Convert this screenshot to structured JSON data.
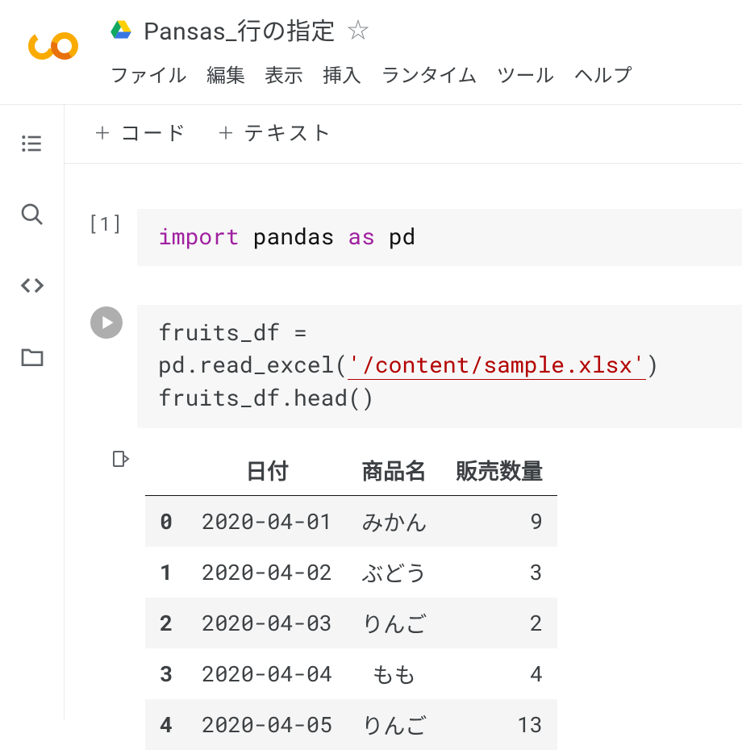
{
  "header": {
    "title": "Pansas_行の指定",
    "menubar": [
      "ファイル",
      "編集",
      "表示",
      "挿入",
      "ランタイム",
      "ツール",
      "ヘルプ"
    ]
  },
  "toolbar": {
    "add_code": "コード",
    "add_text": "テキスト"
  },
  "cells": [
    {
      "exec_label": "[1]",
      "code_parts": {
        "kw1": "import",
        "mod": "pandas",
        "kw2": "as",
        "alias": "pd"
      }
    },
    {
      "code_line1_prefix": "fruits_df = pd.read_excel(",
      "code_line1_str": "'/content/sample.xlsx'",
      "code_line1_suffix": ")",
      "code_line2": "fruits_df.head()"
    }
  ],
  "output": {
    "columns": [
      "日付",
      "商品名",
      "販売数量"
    ],
    "rows": [
      {
        "idx": "0",
        "date": "2020-04-01",
        "name": "みかん",
        "qty": "9"
      },
      {
        "idx": "1",
        "date": "2020-04-02",
        "name": "ぶどう",
        "qty": "3"
      },
      {
        "idx": "2",
        "date": "2020-04-03",
        "name": "りんご",
        "qty": "2"
      },
      {
        "idx": "3",
        "date": "2020-04-04",
        "name": "もも",
        "qty": "4"
      },
      {
        "idx": "4",
        "date": "2020-04-05",
        "name": "りんご",
        "qty": "13"
      }
    ]
  }
}
